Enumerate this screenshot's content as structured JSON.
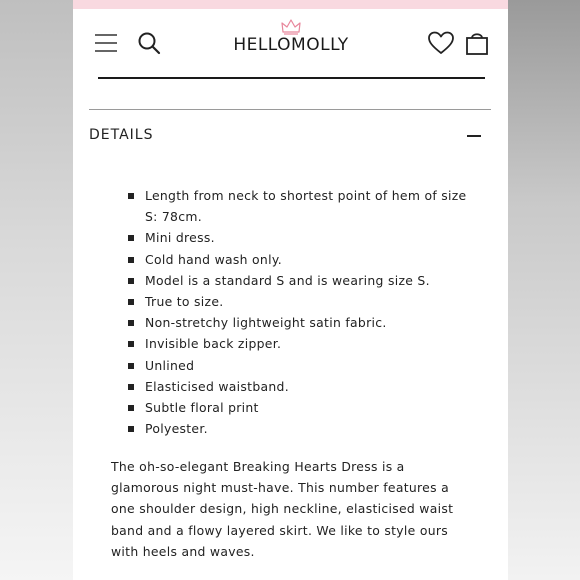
{
  "brand": {
    "logo_text": "HELLOMOLLY"
  },
  "colors": {
    "promo_strip": "#f9d9e0",
    "accent_pink": "#e8879c"
  },
  "icons": {
    "menu": "hamburger-menu-icon",
    "search": "search-icon",
    "wishlist": "heart-icon",
    "bag": "shopping-bag-icon",
    "collapse": "minus-icon"
  },
  "details": {
    "title": "DETAILS",
    "bullets": [
      "Length from neck to shortest point of hem of size S: 78cm.",
      "Mini dress.",
      "Cold hand wash only.",
      "Model is a standard S and is wearing size S.",
      "True to size.",
      "Non-stretchy lightweight satin fabric.",
      "Invisible back zipper.",
      "Unlined",
      "Elasticised waistband.",
      "Subtle floral print",
      "Polyester."
    ],
    "description": "The oh-so-elegant Breaking Hearts Dress is a glamorous night must-have. This number features a one shoulder design, high neckline, elasticised waist band and a flowy layered skirt. We like to style ours with heels and waves."
  }
}
